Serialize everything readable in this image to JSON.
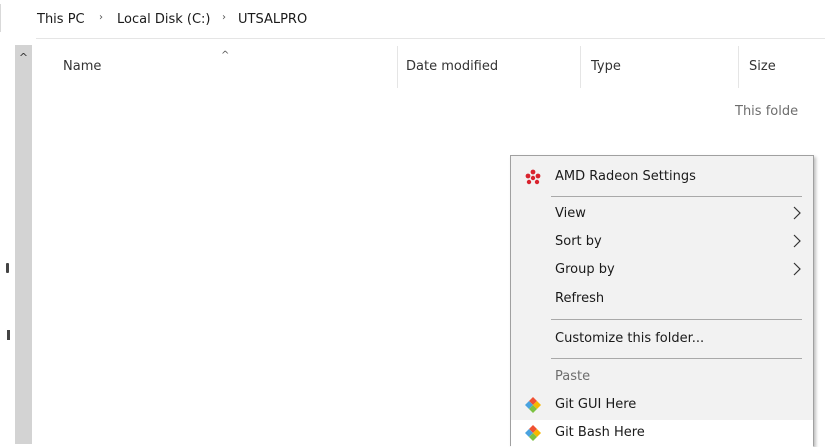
{
  "breadcrumb": {
    "items": [
      "This PC",
      "Local Disk (C:)",
      "UTSALPRO"
    ],
    "separator": "›"
  },
  "nav": {
    "up_glyph": "^"
  },
  "columns": {
    "sort_glyph": "^",
    "headers": [
      "Name",
      "Date modified",
      "Type",
      "Size"
    ]
  },
  "empty_message": "This folde",
  "context_menu": {
    "items": [
      {
        "label": "AMD Radeon Settings",
        "icon": "amd-radeon-icon"
      },
      {
        "label": "View",
        "submenu": true
      },
      {
        "label": "Sort by",
        "submenu": true
      },
      {
        "label": "Group by",
        "submenu": true
      },
      {
        "label": "Refresh"
      },
      {
        "label": "Customize this folder..."
      },
      {
        "label": "Paste",
        "disabled": true
      },
      {
        "label": "Git GUI Here",
        "icon": "git-icon"
      },
      {
        "label": "Git Bash Here",
        "icon": "git-icon",
        "highlighted": true
      }
    ]
  },
  "colors": {
    "menu_bg": "#f2f2f2",
    "amd_red": "#d9232e",
    "git_orange": "#f05133",
    "git_blue": "#4aa3df",
    "git_yellow": "#f5b800",
    "disabled_text": "#6d6d6d"
  }
}
